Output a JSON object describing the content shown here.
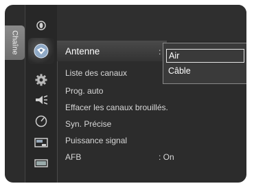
{
  "sidebar": {
    "tab_label": "Chaîne",
    "icons": [
      "input-icon",
      "channel-antenna-icon",
      "setup-gear-icon",
      "sound-icon",
      "timer-icon",
      "picture-icon",
      "input-source-icon"
    ],
    "selected_icon": "channel-antenna-icon"
  },
  "menu": {
    "items": [
      {
        "label": "Antenne",
        "value": ":"
      },
      {
        "label": "Liste des canaux",
        "value": ""
      },
      {
        "label": "Prog. auto",
        "value": ""
      },
      {
        "label": "Effacer les canaux brouillés.",
        "value": ""
      },
      {
        "label": "Syn. Précise",
        "value": ""
      },
      {
        "label": "Puissance signal",
        "value": ""
      },
      {
        "label": "AFB",
        "value": ": On"
      }
    ],
    "selected_index": 0
  },
  "dropdown": {
    "options": [
      "Air",
      "Câble"
    ],
    "selected": "Air"
  },
  "colors": {
    "background": "#2c2c2c",
    "text": "#d8d8d8",
    "highlight_border": "#e6e6e6"
  }
}
